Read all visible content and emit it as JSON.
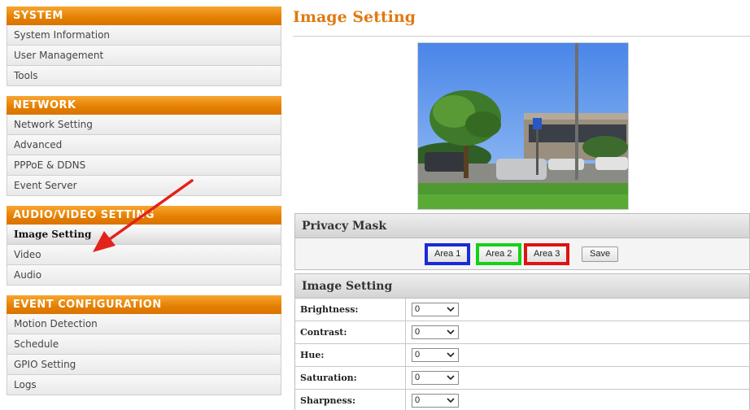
{
  "sidebar": {
    "sections": [
      {
        "title": "SYSTEM",
        "items": [
          "System Information",
          "User Management",
          "Tools"
        ]
      },
      {
        "title": "NETWORK",
        "items": [
          "Network Setting",
          "Advanced",
          "PPPoE & DDNS",
          "Event Server"
        ]
      },
      {
        "title": "AUDIO/VIDEO SETTING",
        "items": [
          "Image Setting",
          "Video",
          "Audio"
        ]
      },
      {
        "title": "EVENT CONFIGURATION",
        "items": [
          "Motion Detection",
          "Schedule",
          "GPIO Setting",
          "Logs"
        ]
      }
    ],
    "active_item": "Image Setting"
  },
  "main": {
    "title": "Image Setting",
    "privacy_mask": {
      "heading": "Privacy Mask",
      "areas": [
        {
          "label": "Area 1",
          "color": "#1a2bd6"
        },
        {
          "label": "Area 2",
          "color": "#18d018"
        },
        {
          "label": "Area 3",
          "color": "#e01212"
        }
      ],
      "save_label": "Save"
    },
    "image_setting": {
      "heading": "Image Setting",
      "rows": [
        {
          "label": "Brightness:",
          "value": "0"
        },
        {
          "label": "Contrast:",
          "value": "0"
        },
        {
          "label": "Hue:",
          "value": "0"
        },
        {
          "label": "Saturation:",
          "value": "0"
        },
        {
          "label": "Sharpness:",
          "value": "0"
        }
      ]
    }
  },
  "colors": {
    "accent": "#e47f00",
    "annotation_arrow": "#e32219"
  },
  "icons": {
    "select_caret": "chevron-down-icon",
    "annotation": "arrow-icon"
  }
}
